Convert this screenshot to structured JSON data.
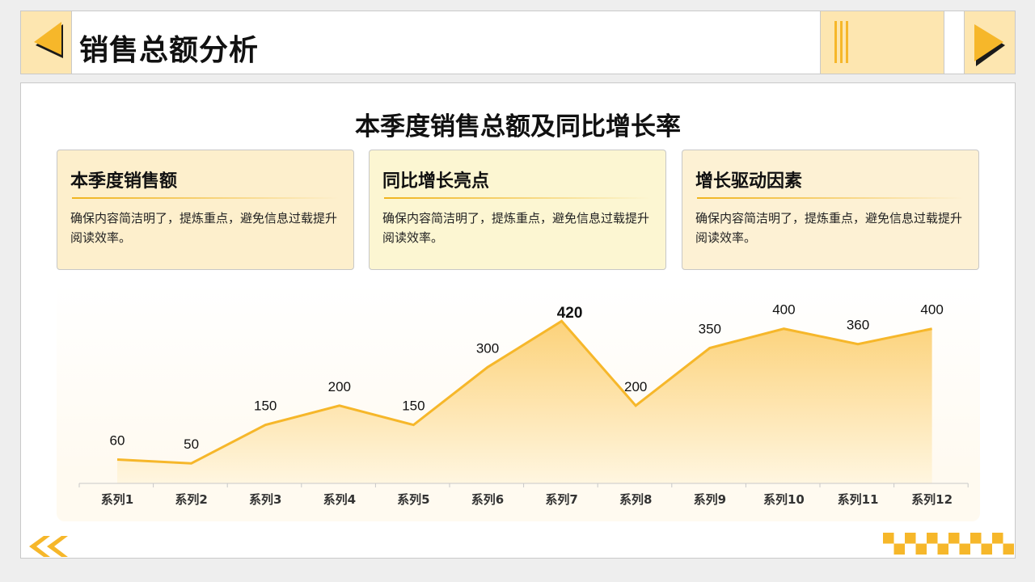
{
  "header": {
    "title": "销售总额分析"
  },
  "main_title": "本季度销售总额及同比增长率",
  "cards": [
    {
      "title": "本季度销售额",
      "body": "确保内容简洁明了，提炼重点，避免信息过载提升阅读效率。",
      "bg": "#fdefcc"
    },
    {
      "title": "同比增长亮点",
      "body": "确保内容简洁明了，提炼重点，避免信息过载提升阅读效率。",
      "bg": "#fcf6d2"
    },
    {
      "title": "增长驱动因素",
      "body": "确保内容简洁明了，提炼重点，避免信息过载提升阅读效率。",
      "bg": "#fdf1d4"
    }
  ],
  "colors": {
    "accent": "#f6b72a",
    "accent_light": "#fde6b0",
    "fill_top": "#fcd27a",
    "fill_bottom": "#fff6e0"
  },
  "chart_data": {
    "type": "area",
    "categories": [
      "系列1",
      "系列2",
      "系列3",
      "系列4",
      "系列5",
      "系列6",
      "系列7",
      "系列8",
      "系列9",
      "系列10",
      "系列11",
      "系列12"
    ],
    "values": [
      60,
      50,
      150,
      200,
      150,
      300,
      420,
      200,
      350,
      400,
      360,
      400
    ],
    "highlight_index": 6,
    "ylim": [
      0,
      480
    ],
    "grid": false
  }
}
